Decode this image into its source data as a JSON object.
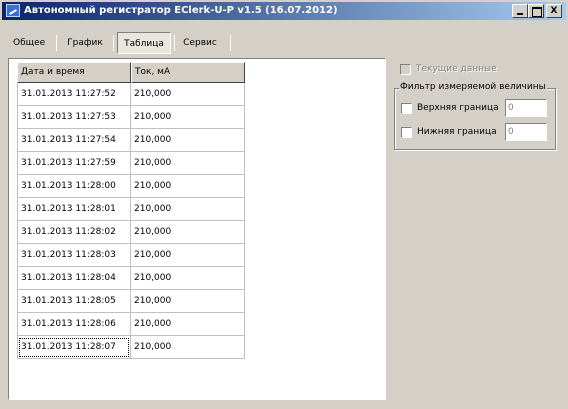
{
  "window": {
    "title": "Автономный регистратор EClerk-U-P v1.5 (16.07.2012)",
    "close_label": "X"
  },
  "tabs": [
    {
      "label": "Общее"
    },
    {
      "label": "График"
    },
    {
      "label": "Таблица",
      "selected": true
    },
    {
      "label": "Сервис"
    }
  ],
  "table": {
    "columns": [
      "Дата и время",
      "Ток, мА"
    ],
    "rows": [
      [
        "31.01.2013 11:27:52",
        "210,000"
      ],
      [
        "31.01.2013 11:27:53",
        "210,000"
      ],
      [
        "31.01.2013 11:27:54",
        "210,000"
      ],
      [
        "31.01.2013 11:27:59",
        "210,000"
      ],
      [
        "31.01.2013 11:28:00",
        "210,000"
      ],
      [
        "31.01.2013 11:28:01",
        "210,000"
      ],
      [
        "31.01.2013 11:28:02",
        "210,000"
      ],
      [
        "31.01.2013 11:28:03",
        "210,000"
      ],
      [
        "31.01.2013 11:28:04",
        "210,000"
      ],
      [
        "31.01.2013 11:28:05",
        "210,000"
      ],
      [
        "31.01.2013 11:28:06",
        "210,000"
      ],
      [
        "31.01.2013 11:28:07",
        "210,000"
      ]
    ]
  },
  "current_data": {
    "label": "Текущие данные",
    "enabled": false,
    "checked": false
  },
  "filter": {
    "title": "Фильтр измеряемой величины",
    "upper": {
      "label": "Верхняя граница",
      "value": "0"
    },
    "lower": {
      "label": "Нижняя граница",
      "value": "0"
    }
  }
}
